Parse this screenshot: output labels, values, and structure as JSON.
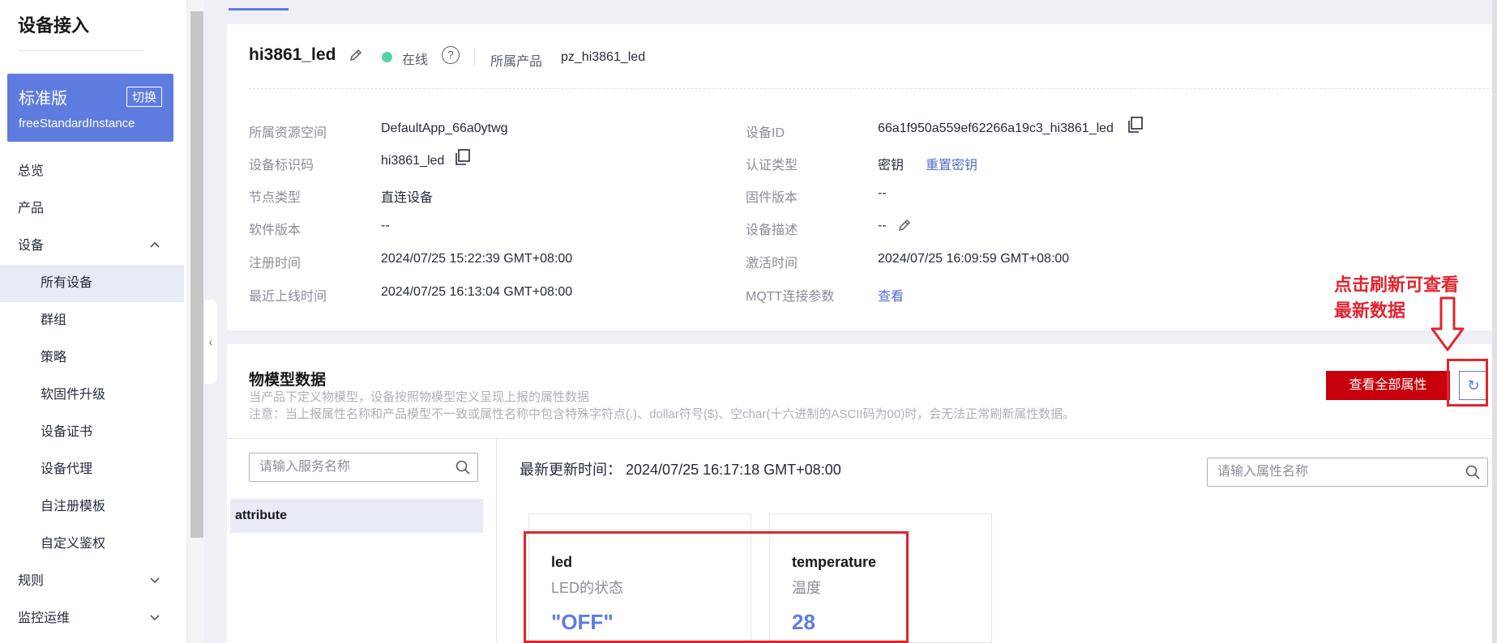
{
  "sidebar": {
    "title": "设备接入",
    "edition": {
      "name": "标准版",
      "switch_label": "切换",
      "instance": "freeStandardInstance"
    },
    "items": [
      {
        "label": "总览"
      },
      {
        "label": "产品"
      },
      {
        "label": "设备"
      },
      {
        "label": "所有设备"
      },
      {
        "label": "群组"
      },
      {
        "label": "策略"
      },
      {
        "label": "软固件升级"
      },
      {
        "label": "设备证书"
      },
      {
        "label": "设备代理"
      },
      {
        "label": "自注册模板"
      },
      {
        "label": "自定义鉴权"
      },
      {
        "label": "规则"
      },
      {
        "label": "监控运维"
      }
    ],
    "collapse_glyph": "‹"
  },
  "device": {
    "name": "hi3861_led",
    "status": "在线",
    "product_label": "所属产品",
    "product_value": "pz_hi3861_led",
    "help_glyph": "?"
  },
  "info": {
    "left": [
      {
        "label": "所属资源空间",
        "value": "DefaultApp_66a0ytwg"
      },
      {
        "label": "设备标识码",
        "value": "hi3861_led"
      },
      {
        "label": "节点类型",
        "value": "直连设备"
      },
      {
        "label": "软件版本",
        "value": "--"
      },
      {
        "label": "注册时间",
        "value": "2024/07/25 15:22:39 GMT+08:00"
      },
      {
        "label": "最近上线时间",
        "value": "2024/07/25 16:13:04 GMT+08:00"
      }
    ],
    "right": [
      {
        "label": "设备ID",
        "value": "66a1f950a559ef62266a19c3_hi3861_led"
      },
      {
        "label": "认证类型",
        "value": "密钥",
        "link": "重置密钥"
      },
      {
        "label": "固件版本",
        "value": "--"
      },
      {
        "label": "设备描述",
        "value": "--"
      },
      {
        "label": "激活时间",
        "value": "2024/07/25 16:09:59 GMT+08:00"
      },
      {
        "label": "MQTT连接参数",
        "link": "查看"
      }
    ]
  },
  "model": {
    "title": "物模型数据",
    "note1": "当产品下定义物模型，设备按照物模型定义呈现上报的属性数据",
    "note2": "注意：当上报属性名称和产品模型不一致或属性名称中包含特殊字符点(.)、dollar符号($)、空char(十六进制的ASCII码为00)时，会无法正常刷新属性数据。",
    "view_all_label": "查看全部属性",
    "refresh_glyph": "↻",
    "service_search_placeholder": "请输入服务名称",
    "property_search_placeholder": "请输入属性名称",
    "service_selected": "attribute",
    "update_label": "最新更新时间：",
    "update_time": "2024/07/25 16:17:18 GMT+08:00",
    "cards": [
      {
        "name": "led",
        "desc": "LED的状态",
        "value": "\"OFF\""
      },
      {
        "name": "temperature",
        "desc": "温度",
        "value": "28"
      }
    ]
  },
  "annotation": {
    "line1": "点击刷新可查看",
    "line2": "最新数据",
    "arrow": "⇩"
  },
  "colors": {
    "brand": "#5e7ce0",
    "danger": "#c7000b",
    "annotation": "#e1252f",
    "online": "#50d4ab"
  }
}
